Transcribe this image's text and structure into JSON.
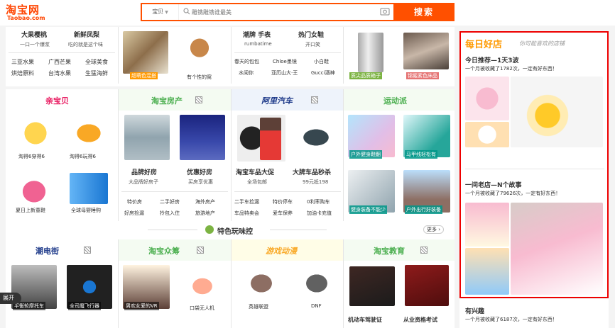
{
  "header": {
    "logo_cn": "淘宝网",
    "logo_en": "Taobao.com",
    "scope": "宝贝",
    "search_placeholder": "雕镌雕镌谁最美",
    "search_button": "搜索"
  },
  "row1": {
    "c1": {
      "line1a": "大果樱桃",
      "line1b": "新鲜凤梨",
      "line2a": "一口一个爆浆",
      "line2b": "吃的就是这个味",
      "items": [
        "三亚水果",
        "广西芒果",
        "全球美食",
        "烘焙原料",
        "台湾水果",
        "生猛海鲜"
      ]
    },
    "c2": {
      "cap1": "超萌色混搭",
      "cap2": "有个性的窝"
    },
    "c3": {
      "line1a": "潮牌 手表",
      "line1b": "热门女鞋",
      "line2a": "rumbatime",
      "line2b": "开口笑",
      "items": [
        "春天的包包",
        "Chloe墨镜",
        "小白鞋",
        "水闺你",
        "亚历山大·王",
        "Gucci酒神"
      ]
    },
    "c4": {
      "cap1": "质尖品质箱子",
      "cap2": "锦瘢素色床品"
    }
  },
  "row2": {
    "baby": {
      "brand": "亲宝贝",
      "cap1": "淘得6穿得6",
      "cap2": "淘得6玩得6",
      "cap3": "夏日上新童鞋",
      "cap4": "全球母婴睡购"
    },
    "house": {
      "brand": "淘宝房产",
      "title1": "品牌好房",
      "sub1": "大品牌好房子",
      "title2": "优惠好房",
      "sub2": "买房享优惠",
      "items": [
        "特价房",
        "二手好房",
        "海外房产",
        "好房捡漏",
        "拎包入住",
        "旅游地产"
      ]
    },
    "car": {
      "brand": "阿里汽车",
      "title1": "淘宝车品大促",
      "sub1": "全场包邮",
      "title2": "大牌车品秒杀",
      "sub2": "99元抵198",
      "items": [
        "二手车捡漏",
        "特价停车",
        "0利率购车",
        "车品特卖会",
        "爱车保养",
        "加油卡充值"
      ]
    },
    "sport": {
      "brand": "运动派",
      "cap1": "户外健身鞋翻",
      "cap2": "马甲线轻松有",
      "cap3": "健身装备不能少",
      "cap4": "户外出行好装备"
    }
  },
  "section": {
    "title": "特色玩味控",
    "more": "更多"
  },
  "row3": {
    "street": {
      "brand": "潮电街",
      "cap1": "平衡轮摩托车",
      "cap2": "全司魔飞行器"
    },
    "crowd": {
      "brand": "淘宝众筹",
      "cap1": "男欢女爱的VR",
      "cap2": "口袋无人机"
    },
    "game": {
      "brand": "游戏动漫",
      "cap1": "英雄联盟",
      "cap2": "DNF"
    },
    "edu": {
      "brand": "淘宝教育",
      "cap1": "机动车驾驶证",
      "cap2": "从业资格考试"
    }
  },
  "expand": "展开",
  "right": {
    "head": "每日好店",
    "slogan": "你可能喜欢的店铺",
    "s1": {
      "title": "今日推荐—1天3波",
      "sub": "一个月被收藏了1782次，一定有好东西！"
    },
    "s2": {
      "title": "一间老店—N个故事",
      "sub": "一个月被收藏了79626次，一定有好东西！"
    },
    "s3": {
      "title": "有兴趣",
      "sub": "一个月被收藏了6187次，一定有好东西！"
    }
  }
}
